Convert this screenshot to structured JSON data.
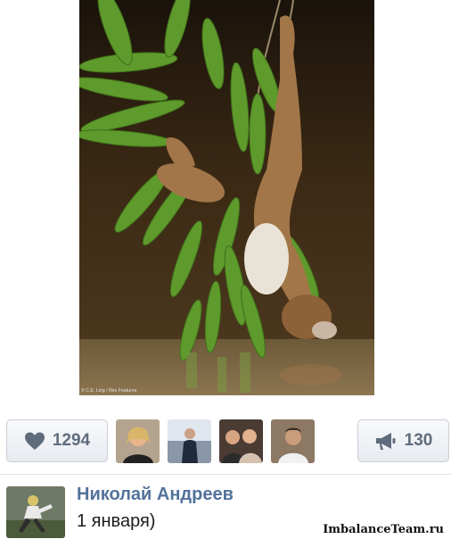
{
  "post": {
    "photo_credit": "© C.E. Ling / Rex Features"
  },
  "actions": {
    "likes": {
      "icon": "heart-icon",
      "count": "1294"
    },
    "shares": {
      "icon": "megaphone-icon",
      "count": "130"
    }
  },
  "liked_by": [
    {
      "icon": "avatar-1"
    },
    {
      "icon": "avatar-2"
    },
    {
      "icon": "avatar-3"
    },
    {
      "icon": "avatar-4"
    }
  ],
  "comment": {
    "author": "Николай Андреев",
    "text": "1 января)"
  },
  "watermark": "ImbalanceTeam.ru",
  "colors": {
    "author_link": "#52729a",
    "button_text": "#5f6c7c",
    "button_border": "#c9ced6"
  }
}
